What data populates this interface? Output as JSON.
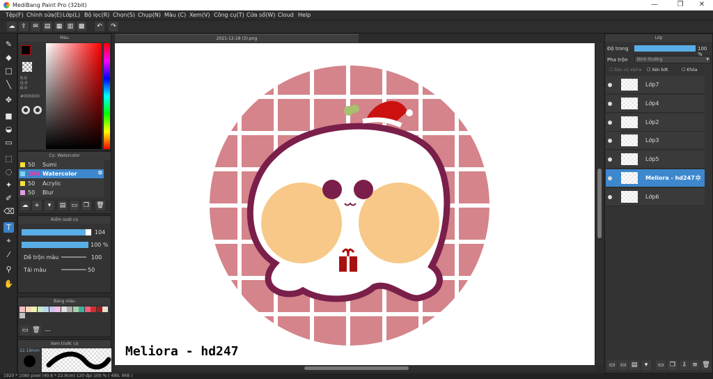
{
  "app": {
    "title": "MediBang Paint Pro (32bit)"
  },
  "menu": [
    "Tệp(F)",
    "Chỉnh sửa(E)",
    "Lớp(L)",
    "Bộ lọc(R)",
    "Chọn(S)",
    "Chụp(N)",
    "Màu (C)",
    "Xem(V)",
    "Công cụ(T)",
    "Cửa sổ(W)",
    "Cloud",
    "Help"
  ],
  "color_panel": {
    "title": "Màu",
    "r": "R:0",
    "g": "G:0",
    "b": "B:0",
    "hex": "#000000"
  },
  "brush_panel": {
    "title": "Cọ: Watercolor",
    "items": [
      {
        "size": "50",
        "name": "Sumi",
        "color": "#f5e13a"
      },
      {
        "size": "104",
        "name": "Watercolor",
        "color": "#7fd3f5",
        "selected": true
      },
      {
        "size": "50",
        "name": "Acrylic",
        "color": "#f5e13a"
      },
      {
        "size": "50",
        "name": "Blur",
        "color": "#e69ae6"
      }
    ]
  },
  "brush_control": {
    "title": "Kiểm soát cọ",
    "size": "104",
    "opacity": "100 %",
    "mix_label": "Dễ trộn màu",
    "mix_value": "100",
    "reload_label": "Tải màu",
    "reload_value": "50"
  },
  "palette": {
    "title": "Bảng màu",
    "more": "---",
    "colors": [
      "#f2c0c0",
      "#f5d9b8",
      "#f0f0b0",
      "#c8e6c8",
      "#b8d8f0",
      "#d0c0f0",
      "#f0c0e0",
      "#e0e0e0",
      "#b0b0b0",
      "#a8d0a8",
      "#40b0a0",
      "#f06080",
      "#d03030",
      "#a02020",
      "#e8e0d0",
      "#c0c0c0"
    ]
  },
  "preview": {
    "title": "Xem trước cọ",
    "size_label": "22.19mm"
  },
  "document": {
    "tab": "2021-12-18 (3).png",
    "signature": "Meliora - hd247"
  },
  "layers_panel": {
    "title": "Lớp",
    "opacity_label": "Độ trong",
    "opacity_value": "100 %",
    "blend_label": "Pha trộn",
    "blend_value": "Bình thường",
    "protect_alpha": "Bảo vệ alpha",
    "clip": "Xén bớt",
    "lock": "Khóa",
    "layers": [
      {
        "name": "Lớp7",
        "selected": false
      },
      {
        "name": "Lớp4",
        "selected": false
      },
      {
        "name": "Lớp2",
        "selected": false
      },
      {
        "name": "Lớp3",
        "selected": false
      },
      {
        "name": "Lớp5",
        "selected": false
      },
      {
        "name": "Meliora - hd247",
        "selected": true
      },
      {
        "name": "Lớp6",
        "selected": false
      }
    ]
  },
  "status": "1920 * 1080 pixel   (40.6 * 22.9cm)   120 dpi   100 %   ( 489, 968 )",
  "colors": {
    "accent": "#3d87cc",
    "panel": "#333333",
    "pink": "#d4848a",
    "outline": "#7a1e4a",
    "cheek": "#f7c887"
  }
}
